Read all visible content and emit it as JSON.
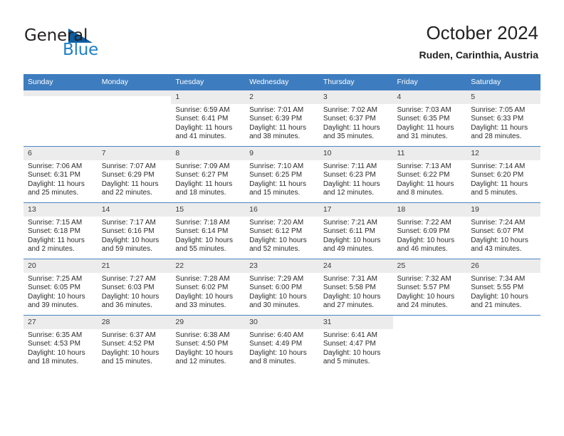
{
  "brand": {
    "name_top": "General",
    "name_bottom": "Blue",
    "color_dark": "#231f20",
    "color_blue": "#1f7fc4",
    "triangle_color": "#0b5fa4"
  },
  "header": {
    "title": "October 2024",
    "subtitle": "Ruden, Carinthia, Austria",
    "header_bg": "#3d7dbf",
    "header_text_color": "#ffffff"
  },
  "weekday_headers": [
    "Sunday",
    "Monday",
    "Tuesday",
    "Wednesday",
    "Thursday",
    "Friday",
    "Saturday"
  ],
  "labels": {
    "sunrise_prefix": "Sunrise:",
    "sunset_prefix": "Sunset:",
    "daylight_prefix": "Daylight:"
  },
  "weeks": [
    [
      {
        "day": "",
        "line1": "",
        "line2": "",
        "line3": "",
        "line4": "",
        "empty": true
      },
      {
        "day": "",
        "line1": "",
        "line2": "",
        "line3": "",
        "line4": "",
        "empty": true
      },
      {
        "day": "1",
        "line1": "Sunrise: 6:59 AM",
        "line2": "Sunset: 6:41 PM",
        "line3": "Daylight: 11 hours",
        "line4": "and 41 minutes."
      },
      {
        "day": "2",
        "line1": "Sunrise: 7:01 AM",
        "line2": "Sunset: 6:39 PM",
        "line3": "Daylight: 11 hours",
        "line4": "and 38 minutes."
      },
      {
        "day": "3",
        "line1": "Sunrise: 7:02 AM",
        "line2": "Sunset: 6:37 PM",
        "line3": "Daylight: 11 hours",
        "line4": "and 35 minutes."
      },
      {
        "day": "4",
        "line1": "Sunrise: 7:03 AM",
        "line2": "Sunset: 6:35 PM",
        "line3": "Daylight: 11 hours",
        "line4": "and 31 minutes."
      },
      {
        "day": "5",
        "line1": "Sunrise: 7:05 AM",
        "line2": "Sunset: 6:33 PM",
        "line3": "Daylight: 11 hours",
        "line4": "and 28 minutes."
      }
    ],
    [
      {
        "day": "6",
        "line1": "Sunrise: 7:06 AM",
        "line2": "Sunset: 6:31 PM",
        "line3": "Daylight: 11 hours",
        "line4": "and 25 minutes."
      },
      {
        "day": "7",
        "line1": "Sunrise: 7:07 AM",
        "line2": "Sunset: 6:29 PM",
        "line3": "Daylight: 11 hours",
        "line4": "and 22 minutes."
      },
      {
        "day": "8",
        "line1": "Sunrise: 7:09 AM",
        "line2": "Sunset: 6:27 PM",
        "line3": "Daylight: 11 hours",
        "line4": "and 18 minutes."
      },
      {
        "day": "9",
        "line1": "Sunrise: 7:10 AM",
        "line2": "Sunset: 6:25 PM",
        "line3": "Daylight: 11 hours",
        "line4": "and 15 minutes."
      },
      {
        "day": "10",
        "line1": "Sunrise: 7:11 AM",
        "line2": "Sunset: 6:23 PM",
        "line3": "Daylight: 11 hours",
        "line4": "and 12 minutes."
      },
      {
        "day": "11",
        "line1": "Sunrise: 7:13 AM",
        "line2": "Sunset: 6:22 PM",
        "line3": "Daylight: 11 hours",
        "line4": "and 8 minutes."
      },
      {
        "day": "12",
        "line1": "Sunrise: 7:14 AM",
        "line2": "Sunset: 6:20 PM",
        "line3": "Daylight: 11 hours",
        "line4": "and 5 minutes."
      }
    ],
    [
      {
        "day": "13",
        "line1": "Sunrise: 7:15 AM",
        "line2": "Sunset: 6:18 PM",
        "line3": "Daylight: 11 hours",
        "line4": "and 2 minutes."
      },
      {
        "day": "14",
        "line1": "Sunrise: 7:17 AM",
        "line2": "Sunset: 6:16 PM",
        "line3": "Daylight: 10 hours",
        "line4": "and 59 minutes."
      },
      {
        "day": "15",
        "line1": "Sunrise: 7:18 AM",
        "line2": "Sunset: 6:14 PM",
        "line3": "Daylight: 10 hours",
        "line4": "and 55 minutes."
      },
      {
        "day": "16",
        "line1": "Sunrise: 7:20 AM",
        "line2": "Sunset: 6:12 PM",
        "line3": "Daylight: 10 hours",
        "line4": "and 52 minutes."
      },
      {
        "day": "17",
        "line1": "Sunrise: 7:21 AM",
        "line2": "Sunset: 6:11 PM",
        "line3": "Daylight: 10 hours",
        "line4": "and 49 minutes."
      },
      {
        "day": "18",
        "line1": "Sunrise: 7:22 AM",
        "line2": "Sunset: 6:09 PM",
        "line3": "Daylight: 10 hours",
        "line4": "and 46 minutes."
      },
      {
        "day": "19",
        "line1": "Sunrise: 7:24 AM",
        "line2": "Sunset: 6:07 PM",
        "line3": "Daylight: 10 hours",
        "line4": "and 43 minutes."
      }
    ],
    [
      {
        "day": "20",
        "line1": "Sunrise: 7:25 AM",
        "line2": "Sunset: 6:05 PM",
        "line3": "Daylight: 10 hours",
        "line4": "and 39 minutes."
      },
      {
        "day": "21",
        "line1": "Sunrise: 7:27 AM",
        "line2": "Sunset: 6:03 PM",
        "line3": "Daylight: 10 hours",
        "line4": "and 36 minutes."
      },
      {
        "day": "22",
        "line1": "Sunrise: 7:28 AM",
        "line2": "Sunset: 6:02 PM",
        "line3": "Daylight: 10 hours",
        "line4": "and 33 minutes."
      },
      {
        "day": "23",
        "line1": "Sunrise: 7:29 AM",
        "line2": "Sunset: 6:00 PM",
        "line3": "Daylight: 10 hours",
        "line4": "and 30 minutes."
      },
      {
        "day": "24",
        "line1": "Sunrise: 7:31 AM",
        "line2": "Sunset: 5:58 PM",
        "line3": "Daylight: 10 hours",
        "line4": "and 27 minutes."
      },
      {
        "day": "25",
        "line1": "Sunrise: 7:32 AM",
        "line2": "Sunset: 5:57 PM",
        "line3": "Daylight: 10 hours",
        "line4": "and 24 minutes."
      },
      {
        "day": "26",
        "line1": "Sunrise: 7:34 AM",
        "line2": "Sunset: 5:55 PM",
        "line3": "Daylight: 10 hours",
        "line4": "and 21 minutes."
      }
    ],
    [
      {
        "day": "27",
        "line1": "Sunrise: 6:35 AM",
        "line2": "Sunset: 4:53 PM",
        "line3": "Daylight: 10 hours",
        "line4": "and 18 minutes."
      },
      {
        "day": "28",
        "line1": "Sunrise: 6:37 AM",
        "line2": "Sunset: 4:52 PM",
        "line3": "Daylight: 10 hours",
        "line4": "and 15 minutes."
      },
      {
        "day": "29",
        "line1": "Sunrise: 6:38 AM",
        "line2": "Sunset: 4:50 PM",
        "line3": "Daylight: 10 hours",
        "line4": "and 12 minutes."
      },
      {
        "day": "30",
        "line1": "Sunrise: 6:40 AM",
        "line2": "Sunset: 4:49 PM",
        "line3": "Daylight: 10 hours",
        "line4": "and 8 minutes."
      },
      {
        "day": "31",
        "line1": "Sunrise: 6:41 AM",
        "line2": "Sunset: 4:47 PM",
        "line3": "Daylight: 10 hours",
        "line4": "and 5 minutes."
      },
      {
        "day": "",
        "line1": "",
        "line2": "",
        "line3": "",
        "line4": "",
        "blank": true
      },
      {
        "day": "",
        "line1": "",
        "line2": "",
        "line3": "",
        "line4": "",
        "blank": true
      }
    ]
  ]
}
